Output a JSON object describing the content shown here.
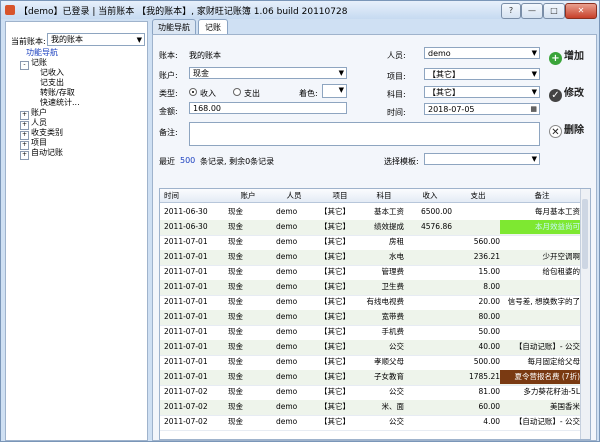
{
  "window": {
    "title": "【demo】已登录 | 当前账本 【我的账本】, 家财旺记账簿 1.06 build 20110728",
    "controls": [
      "?",
      "—",
      "□",
      "✕"
    ]
  },
  "left": {
    "account_label": "当前账本:",
    "account_value": "我的账本",
    "tree": [
      {
        "label": "功能导航",
        "level": 0,
        "toggle": "",
        "selected": true
      },
      {
        "label": "记账",
        "level": 1,
        "toggle": "-"
      },
      {
        "label": "记收入",
        "level": 2,
        "toggle": ""
      },
      {
        "label": "记支出",
        "level": 2,
        "toggle": ""
      },
      {
        "label": "转账/存取",
        "level": 2,
        "toggle": ""
      },
      {
        "label": "快速统计...",
        "level": 2,
        "toggle": ""
      },
      {
        "label": "账户",
        "level": 1,
        "toggle": "+"
      },
      {
        "label": "人员",
        "level": 1,
        "toggle": "+"
      },
      {
        "label": "收支类别",
        "level": 1,
        "toggle": "+"
      },
      {
        "label": "项目",
        "level": 1,
        "toggle": "+"
      },
      {
        "label": "自动记账",
        "level": 1,
        "toggle": "+"
      }
    ]
  },
  "tabs": [
    "功能导航",
    "记账"
  ],
  "form": {
    "book_label": "账本:",
    "book_value": "我的账本",
    "account_label": "账户:",
    "account_value": "现金",
    "type_label": "类型:",
    "type_income": "收入",
    "type_expense": "支出",
    "color_label": "着色:",
    "amount_label": "金额:",
    "amount_value": "168.00",
    "person_label": "人员:",
    "person_value": "demo",
    "project_label": "项目:",
    "project_value": "【其它】",
    "subject_label": "科目:",
    "subject_value": "【其它】",
    "time_label": "时间:",
    "time_value": "2018-07-05",
    "note_label": "备注:",
    "recent_prefix": "最近",
    "recent_count": "500",
    "recent_suffix": "条记录, 剩余0条记录",
    "template_label": "选择模板:"
  },
  "actions": {
    "add": "增加",
    "edit": "修改",
    "delete": "删除"
  },
  "table": {
    "headers": [
      "时间",
      "账户",
      "人员",
      "项目",
      "科目",
      "收入",
      "支出",
      "备注"
    ],
    "rows": [
      [
        "2011-06-30",
        "现金",
        "demo",
        "【其它】",
        "基本工资",
        "6500.00",
        "",
        "每月基本工资",
        ""
      ],
      [
        "2011-06-30",
        "现金",
        "demo",
        "【其它】",
        "绩效提成",
        "4576.86",
        "",
        "本月效益尚可",
        "#7ee831"
      ],
      [
        "2011-07-01",
        "现金",
        "demo",
        "【其它】",
        "房租",
        "",
        "560.00",
        "",
        ""
      ],
      [
        "2011-07-01",
        "现金",
        "demo",
        "【其它】",
        "水电",
        "",
        "236.21",
        "少开空调啊",
        ""
      ],
      [
        "2011-07-01",
        "现金",
        "demo",
        "【其它】",
        "管理费",
        "",
        "15.00",
        "给包租婆的",
        ""
      ],
      [
        "2011-07-01",
        "现金",
        "demo",
        "【其它】",
        "卫生费",
        "",
        "8.00",
        "",
        ""
      ],
      [
        "2011-07-01",
        "现金",
        "demo",
        "【其它】",
        "有线电视费",
        "",
        "20.00",
        "信号差, 想换数字的了",
        ""
      ],
      [
        "2011-07-01",
        "现金",
        "demo",
        "【其它】",
        "宽带费",
        "",
        "80.00",
        "",
        ""
      ],
      [
        "2011-07-01",
        "现金",
        "demo",
        "【其它】",
        "手机费",
        "",
        "50.00",
        "",
        ""
      ],
      [
        "2011-07-01",
        "现金",
        "demo",
        "【其它】",
        "公交",
        "",
        "40.00",
        "【自动记账】- 公交",
        ""
      ],
      [
        "2011-07-01",
        "现金",
        "demo",
        "【其它】",
        "孝顺父母",
        "",
        "500.00",
        "每月固定给父母",
        ""
      ],
      [
        "2011-07-01",
        "现金",
        "demo",
        "【其它】",
        "子女教育",
        "",
        "1785.21",
        "夏令营报名费 (7折)",
        "#7a3a12"
      ],
      [
        "2011-07-02",
        "现金",
        "demo",
        "【其它】",
        "公交",
        "",
        "81.00",
        "多力葵花籽油-5L",
        ""
      ],
      [
        "2011-07-02",
        "现金",
        "demo",
        "【其它】",
        "米、面",
        "",
        "60.00",
        "美国香米",
        ""
      ],
      [
        "2011-07-02",
        "现金",
        "demo",
        "【其它】",
        "公交",
        "",
        "4.00",
        "【自动记账】- 公交",
        ""
      ]
    ]
  }
}
